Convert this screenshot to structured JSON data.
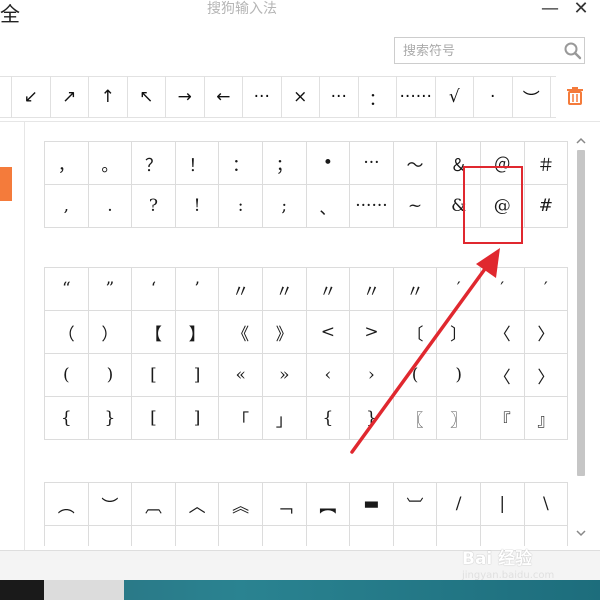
{
  "window": {
    "title": "搜狗输入法",
    "left_title": "全",
    "minimize_glyph": "—",
    "close_glyph": "✕"
  },
  "search": {
    "placeholder": "搜索符号",
    "icon": "search-icon"
  },
  "recent_symbols": [
    "↙",
    "↗",
    "↑",
    "↖",
    "→",
    "←",
    "···",
    "×",
    "···",
    "：",
    "······",
    "√",
    "·",
    "︶"
  ],
  "grid_punct_rows": [
    [
      "，",
      "。",
      "？",
      "！",
      "：",
      "；",
      "•",
      "···",
      "～",
      "＆",
      "＠",
      "＃"
    ],
    [
      ",",
      ".",
      "?",
      "!",
      ":",
      ";",
      "、",
      "······",
      "~",
      "&",
      "@",
      "#"
    ]
  ],
  "grid_brackets_rows": [
    [
      "“",
      "”",
      "‘",
      "’",
      "〃",
      "〃",
      "〃",
      "〃",
      "〃",
      "′",
      "′",
      "′"
    ],
    [
      "（",
      "）",
      "【",
      "】",
      "《",
      "》",
      "<",
      ">",
      "〔",
      "〕",
      "〈",
      "〉"
    ],
    [
      "(",
      ")",
      "[",
      "]",
      "«",
      "»",
      "‹",
      "›",
      "(",
      ")",
      "〈",
      "〉"
    ],
    [
      "{",
      "}",
      "[",
      "]",
      "「",
      "」",
      "{",
      "}",
      "〖",
      "〗",
      "『",
      "』"
    ]
  ],
  "grid_lines_rows": [
    [
      "︵",
      "︶",
      "︹",
      "︿",
      "︽",
      "﹁",
      "︻",
      "▬",
      "︺",
      "/",
      "|",
      "\\"
    ],
    [
      "",
      "",
      "",
      "",
      "",
      "",
      "",
      "",
      "",
      "",
      "",
      ""
    ]
  ],
  "watermark": {
    "text": "Bai 经验",
    "url": "jingyan.baidu.com"
  },
  "colors": {
    "accent": "#f47b3b",
    "highlight": "#e0282f"
  }
}
